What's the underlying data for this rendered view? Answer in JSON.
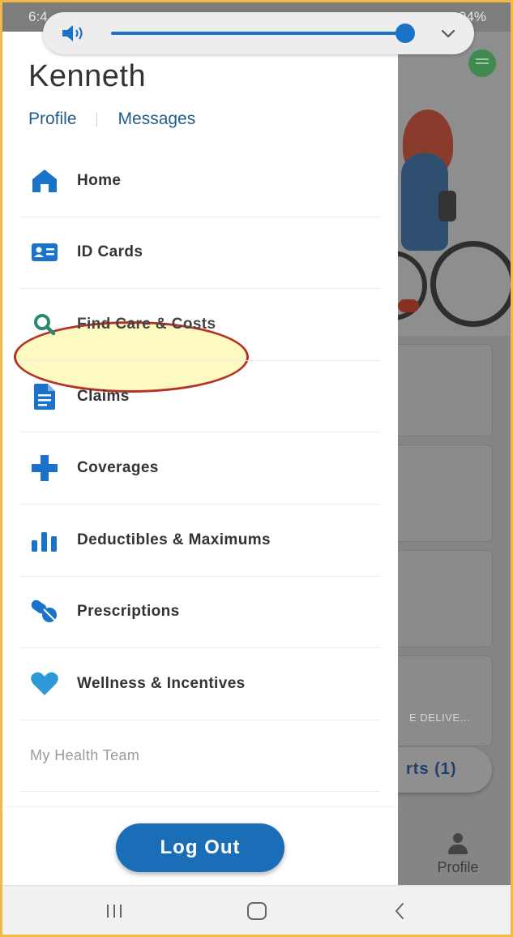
{
  "status_bar": {
    "time": "6:4",
    "battery": "94%"
  },
  "volume": {
    "level": 0.98
  },
  "drawer": {
    "user_name": "Kenneth",
    "links": {
      "profile": "Profile",
      "messages": "Messages"
    },
    "menu": [
      {
        "label": "Home",
        "icon": "home-icon"
      },
      {
        "label": "ID Cards",
        "icon": "id-card-icon"
      },
      {
        "label": "Find Care & Costs",
        "icon": "search-icon"
      },
      {
        "label": "Claims",
        "icon": "document-icon"
      },
      {
        "label": "Coverages",
        "icon": "medical-cross-icon"
      },
      {
        "label": "Deductibles & Maximums",
        "icon": "bar-chart-icon"
      },
      {
        "label": "Prescriptions",
        "icon": "pill-icon"
      },
      {
        "label": "Wellness & Incentives",
        "icon": "heart-icon"
      },
      {
        "label": "My Health Team",
        "icon": ""
      }
    ],
    "logout_label": "Log Out"
  },
  "background_app": {
    "card_text": "E DELIVE...",
    "alerts_pill": "rts (1)",
    "nav_profile_label": "Profile"
  },
  "colors": {
    "accent": "#1a6eb8",
    "icon_blue": "#1a73c8",
    "link": "#1f5d8c",
    "highlight_fill": "#fcfabe",
    "highlight_border": "#b5332a",
    "search_icon": "#2a8a6b"
  }
}
